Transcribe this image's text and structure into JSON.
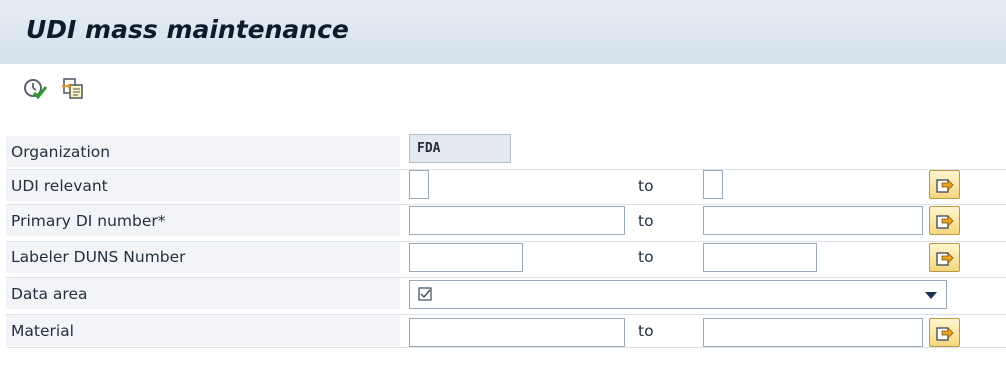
{
  "window": {
    "title": "UDI mass maintenance"
  },
  "toolbar": {
    "buttons": [
      {
        "name": "execute",
        "icon": "execute-clock-check-icon"
      },
      {
        "name": "get-variant",
        "icon": "get-variant-icon"
      }
    ]
  },
  "form": {
    "to_label": "to",
    "organization": {
      "label": "Organization",
      "value": "FDA"
    },
    "udi_relevant": {
      "label": "UDI relevant",
      "low": "",
      "high": ""
    },
    "primary_di": {
      "label": "Primary DI number*",
      "low": "",
      "high": ""
    },
    "labeler_duns": {
      "label": "Labeler DUNS Number",
      "low": "",
      "high": ""
    },
    "data_area": {
      "label": "Data area",
      "selected": "",
      "selected_icon": "checkbox-icon"
    },
    "material": {
      "label": "Material",
      "low": "",
      "high": ""
    }
  },
  "colors": {
    "title_bar": "#dbe4ed",
    "label_bg": "#f2f4f7",
    "multiple_selection_button": "#f4d77e"
  }
}
